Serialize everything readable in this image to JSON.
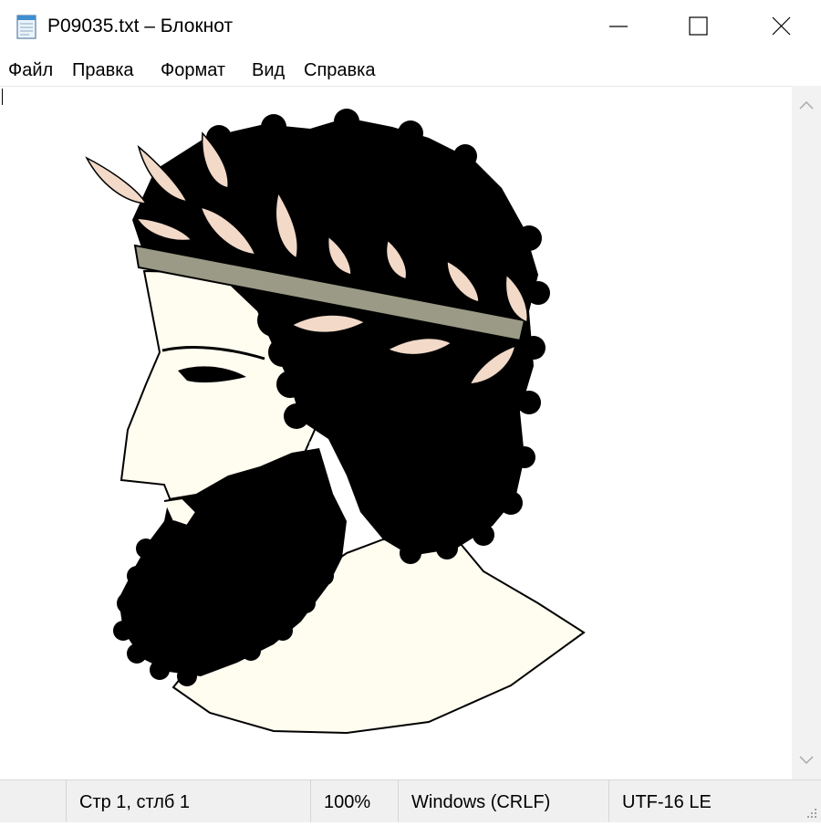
{
  "window": {
    "title": "P09035.txt – Блокнот",
    "icons": {
      "app": "notepad-icon",
      "minimize": "minimize-icon",
      "maximize": "maximize-icon",
      "close": "close-icon"
    }
  },
  "menu": {
    "items": [
      "Файл",
      "Правка",
      "Формат",
      "Вид",
      "Справка"
    ]
  },
  "editor": {
    "content_image": "bearded-laurel-head-illustration",
    "colors": {
      "ink": "#000000",
      "leaf": "#f2d9c8",
      "skin": "#fffdf0",
      "band": "#9a9a86"
    }
  },
  "status": {
    "position": "Стр 1, стлб 1",
    "zoom": "100%",
    "line_endings": "Windows (CRLF)",
    "encoding": "UTF-16 LE"
  }
}
